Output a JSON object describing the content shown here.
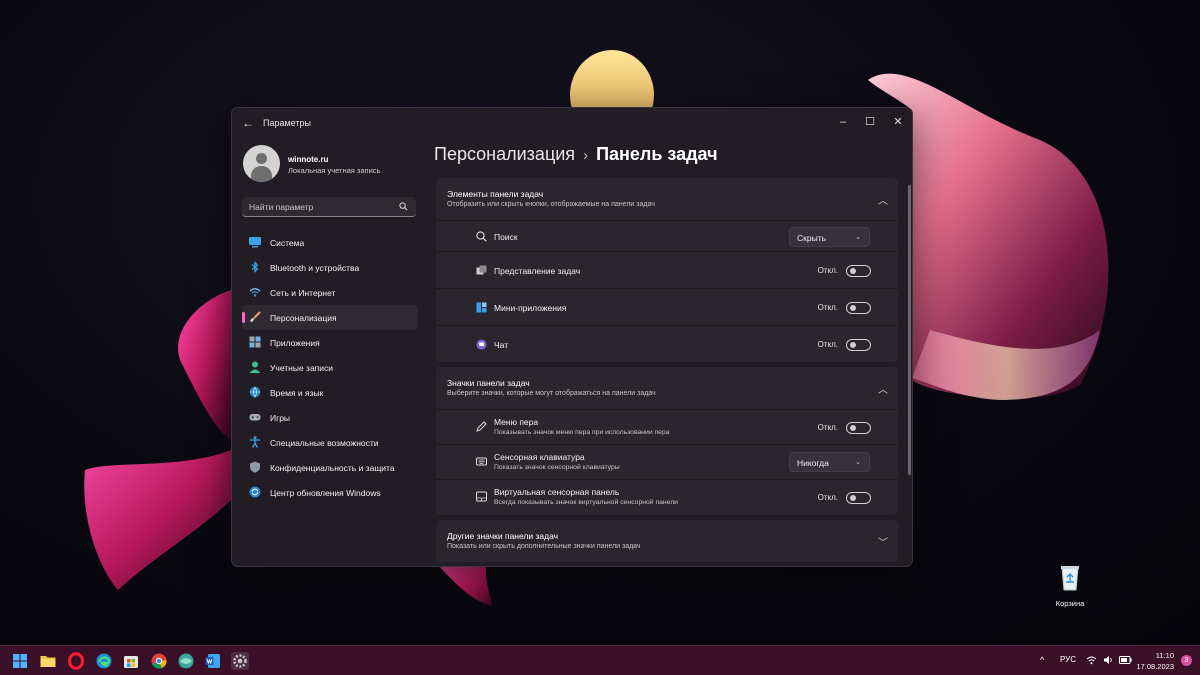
{
  "window": {
    "title": "Параметры",
    "back_icon": "back-arrow-icon",
    "controls": [
      "minimize-icon",
      "maximize-icon",
      "close-icon"
    ]
  },
  "profile": {
    "name": "winnote.ru",
    "account_type": "Локальная учетная запись"
  },
  "search": {
    "placeholder": "Найти параметр"
  },
  "sidebar": {
    "items": [
      {
        "label": "Система",
        "icon": "system-icon"
      },
      {
        "label": "Bluetooth и устройства",
        "icon": "bluetooth-icon"
      },
      {
        "label": "Сеть и Интернет",
        "icon": "wifi-icon"
      },
      {
        "label": "Персонализация",
        "icon": "brush-icon",
        "active": true
      },
      {
        "label": "Приложения",
        "icon": "apps-icon"
      },
      {
        "label": "Учетные записи",
        "icon": "account-icon"
      },
      {
        "label": "Время и язык",
        "icon": "globe-icon"
      },
      {
        "label": "Игры",
        "icon": "gamepad-icon"
      },
      {
        "label": "Специальные возможности",
        "icon": "accessibility-icon"
      },
      {
        "label": "Конфиденциальность и защита",
        "icon": "shield-icon"
      },
      {
        "label": "Центр обновления Windows",
        "icon": "update-icon"
      }
    ]
  },
  "breadcrumb": {
    "parent": "Персонализация",
    "separator": "›",
    "current": "Панель задач"
  },
  "sections": {
    "items": {
      "title": "Элементы панели задач",
      "desc": "Отобразить или скрыть кнопки, отображаемые на панели задач",
      "rows": [
        {
          "label": "Поиск",
          "control": "dropdown",
          "value": "Скрыть",
          "icon": "search-icon"
        },
        {
          "label": "Представление задач",
          "control": "toggle",
          "value": "Откл.",
          "icon": "task-view-icon"
        },
        {
          "label": "Мини-приложения",
          "control": "toggle",
          "value": "Откл.",
          "icon": "widgets-icon"
        },
        {
          "label": "Чат",
          "control": "toggle",
          "value": "Откл.",
          "icon": "chat-icon"
        }
      ]
    },
    "icons": {
      "title": "Значки панели задач",
      "desc": "Выберите значки, которые могут отображаться на панели задач",
      "rows": [
        {
          "label": "Меню пера",
          "desc": "Показывать значок меню пера при использовании пера",
          "control": "toggle",
          "value": "Откл.",
          "icon": "pen-icon"
        },
        {
          "label": "Сенсорная клавиатура",
          "desc": "Показать значок сенсорной клавиатуры",
          "control": "dropdown",
          "value": "Никогда",
          "icon": "keyboard-icon"
        },
        {
          "label": "Виртуальная сенсорная панель",
          "desc": "Всегда показывать значок виртуальной сенсорной панели",
          "control": "toggle",
          "value": "Откл.",
          "icon": "touchpad-icon"
        }
      ]
    },
    "other": {
      "title": "Другие значки панели задач",
      "desc": "Показать или скрыть дополнительные значки панели задач"
    }
  },
  "desktop": {
    "recycle_bin_label": "Корзина"
  },
  "taskbar": {
    "apps": [
      "start-icon",
      "file-explorer-icon",
      "opera-icon",
      "edge-icon",
      "store-icon",
      "chrome-icon",
      "browser-icon",
      "word-icon",
      "settings-icon"
    ],
    "language": "РУС",
    "time": "11:10",
    "date": "17.08.2023",
    "notifications": "3"
  },
  "colors": {
    "accent": "#ff69c6",
    "taskbar": "#3a1028",
    "window_bg": "#221d24",
    "card_bg": "#2b262d"
  }
}
